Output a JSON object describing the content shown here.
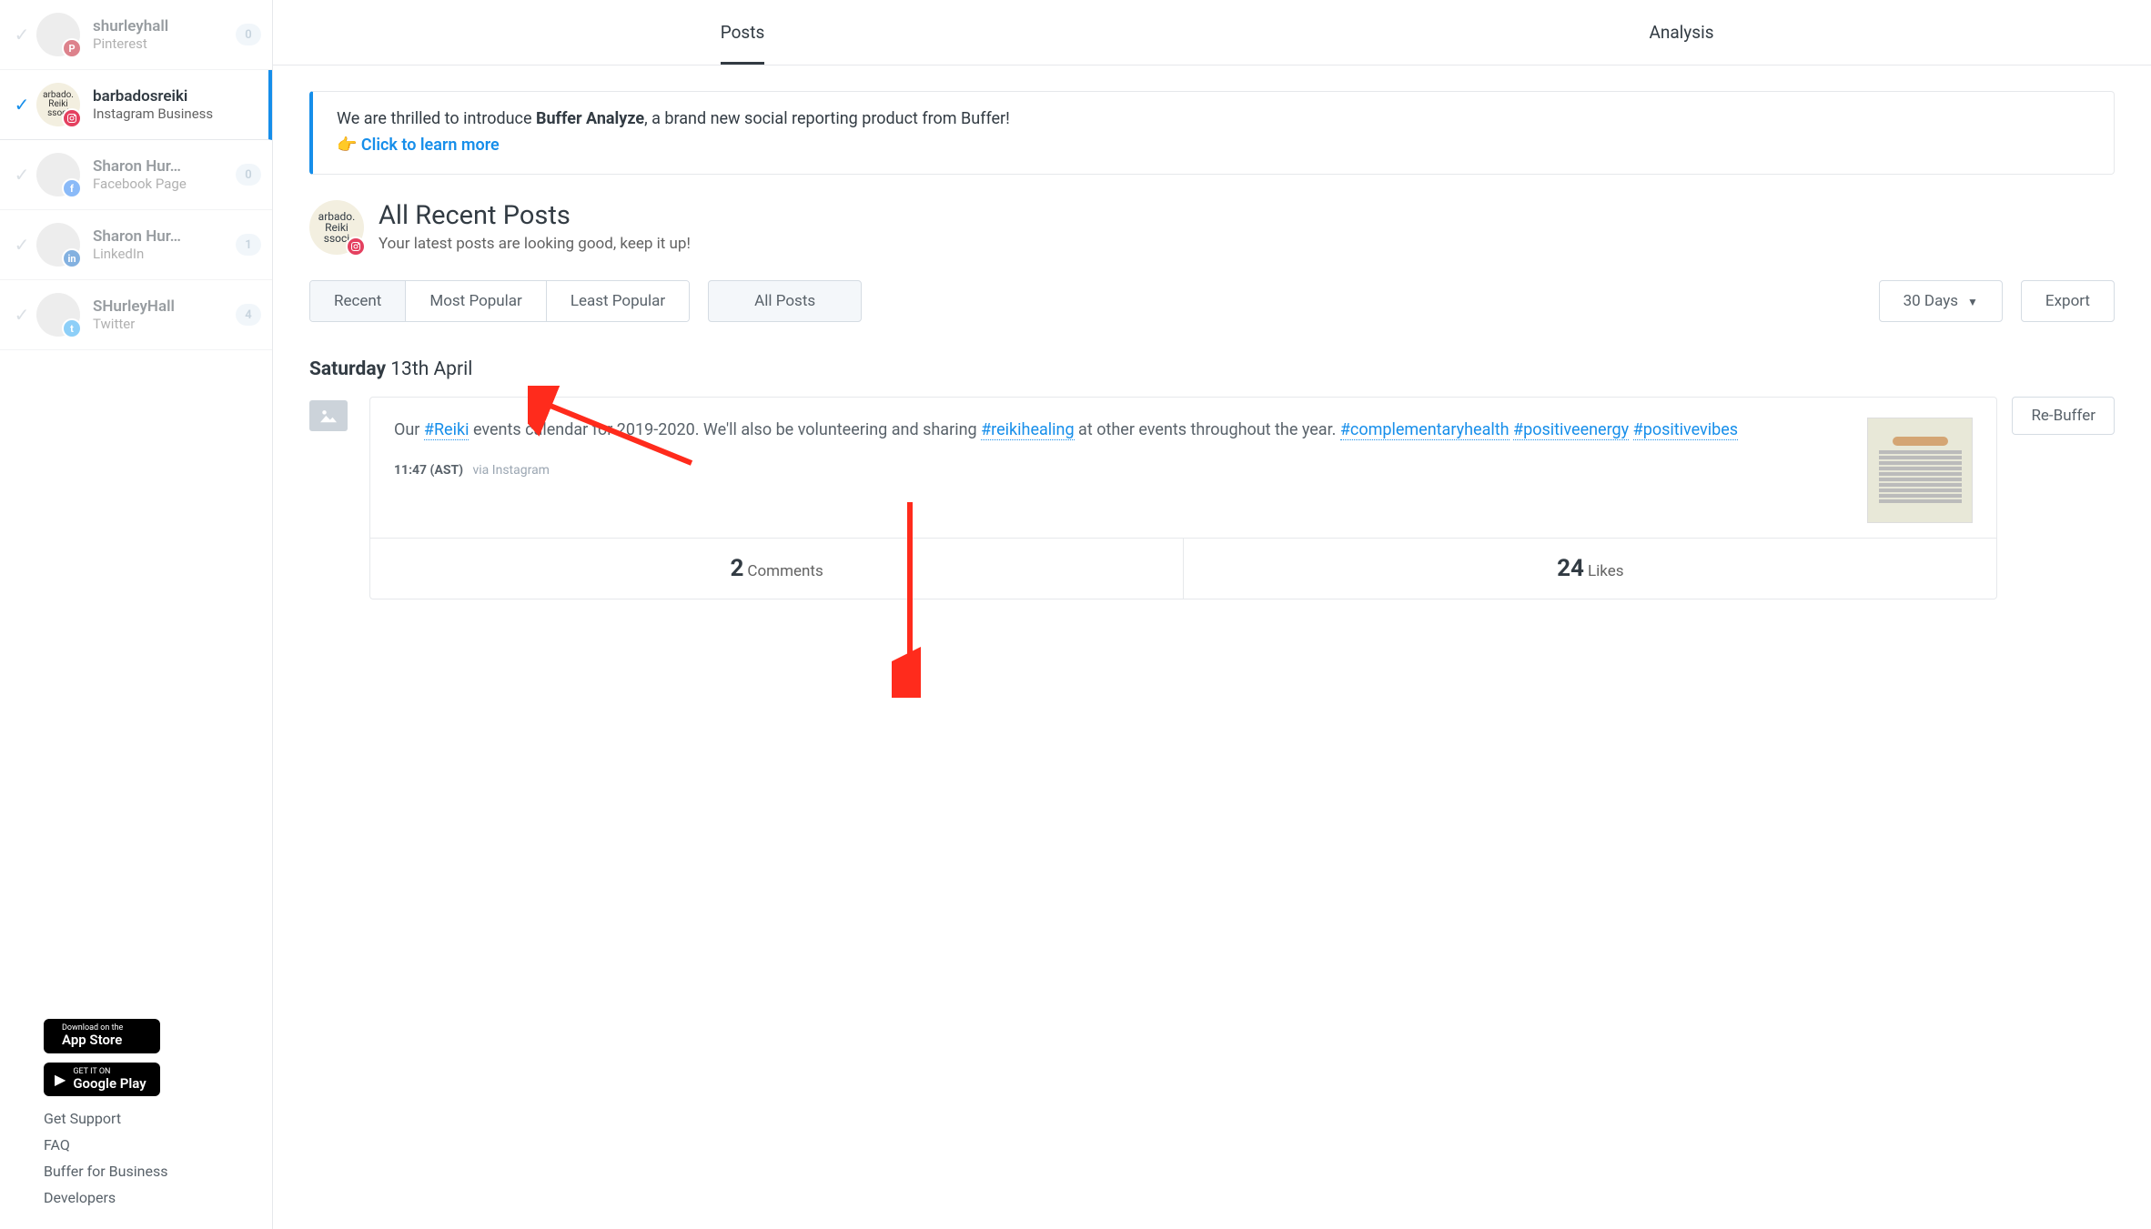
{
  "sidebar": {
    "accounts": [
      {
        "name": "shurleyhall",
        "type": "Pinterest",
        "network": "pinterest",
        "badge_letter": "P",
        "count": "0",
        "active": false,
        "avatar_label": ""
      },
      {
        "name": "barbadosreiki",
        "type": "Instagram Business",
        "network": "instagram",
        "badge_letter": "ig",
        "count": null,
        "active": true,
        "avatar_label": "arbado.\nReiki\nssoci"
      },
      {
        "name": "Sharon Hur…",
        "type": "Facebook Page",
        "network": "facebook",
        "badge_letter": "f",
        "count": "0",
        "active": false,
        "avatar_label": ""
      },
      {
        "name": "Sharon Hur…",
        "type": "LinkedIn",
        "network": "linkedin",
        "badge_letter": "in",
        "count": "1",
        "active": false,
        "avatar_label": ""
      },
      {
        "name": "SHurleyHall",
        "type": "Twitter",
        "network": "twitter",
        "badge_letter": "t",
        "count": "4",
        "active": false,
        "avatar_label": ""
      }
    ],
    "store": {
      "app_store_small": "Download on the",
      "app_store_big": "App Store",
      "google_play_small": "GET IT ON",
      "google_play_big": "Google Play"
    },
    "footer": [
      "Get Support",
      "FAQ",
      "Buffer for Business",
      "Developers"
    ]
  },
  "tabs": [
    "Posts",
    "Analysis"
  ],
  "banner": {
    "pre": "We are thrilled to introduce ",
    "bold": "Buffer Analyze",
    "post": ", a brand new social reporting product from Buffer!",
    "link": "Click to learn more",
    "emoji": "👉"
  },
  "recent": {
    "title": "All Recent Posts",
    "sub": "Your latest posts are looking good, keep it up!",
    "avatar_label": "arbado.\nReiki\nssoci"
  },
  "toolbar": {
    "sort": [
      "Recent",
      "Most Popular",
      "Least Popular"
    ],
    "all_posts": "All Posts",
    "timeframe": "30 Days",
    "export": "Export"
  },
  "date": {
    "day": "Saturday",
    "rest": " 13th April"
  },
  "post": {
    "text_parts": [
      {
        "t": "Our "
      },
      {
        "h": "#Reiki"
      },
      {
        "t": " events calendar for 2019-2020. We'll also be volunteering and sharing "
      },
      {
        "h": "#reikihealing"
      },
      {
        "t": " at other events throughout the year. "
      },
      {
        "h": "#complementaryhealth"
      },
      {
        "t": " "
      },
      {
        "h": "#positiveenergy"
      },
      {
        "t": " "
      },
      {
        "h": "#positivevibes"
      }
    ],
    "time": "11:47 (AST)",
    "source": "via Instagram",
    "comments_num": "2",
    "comments_label": "Comments",
    "likes_num": "24",
    "likes_label": "Likes",
    "rebuffer": "Re-Buffer"
  }
}
